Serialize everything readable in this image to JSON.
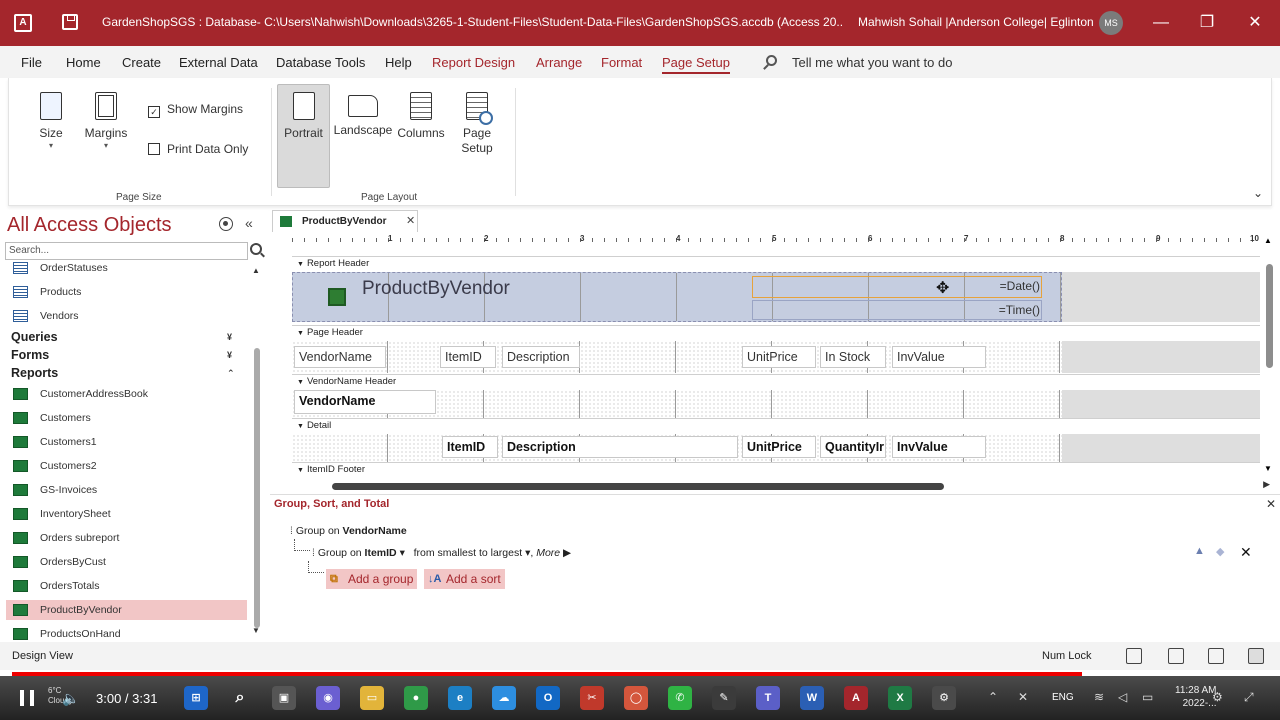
{
  "window": {
    "title": "GardenShopSGS : Database- C:\\Users\\Nahwish\\Downloads\\3265-1-Student-Files\\Student-Data-Files\\GardenShopSGS.accdb (Access 20...",
    "user": "Mahwish Sohail |Anderson College| Eglinton",
    "avatar": "MS",
    "minimize": "—",
    "restore": "❐",
    "close": "✕"
  },
  "menu": {
    "tabs": [
      "File",
      "Home",
      "Create",
      "External Data",
      "Database Tools",
      "Help",
      "Report Design",
      "Arrange",
      "Format",
      "Page Setup"
    ],
    "active": "Page Setup",
    "tell_me": "Tell me what you want to do"
  },
  "ribbon": {
    "size": "Size",
    "margins": "Margins",
    "show_margins": "Show Margins",
    "print_data_only": "Print Data Only",
    "group_page_size": "Page Size",
    "portrait": "Portrait",
    "landscape": "Landscape",
    "columns": "Columns",
    "page_setup_line1": "Page",
    "page_setup_line2": "Setup",
    "group_page_layout": "Page Layout",
    "caret": "▾",
    "collapse": "⌄",
    "show_margins_checked": true,
    "print_data_only_checked": false
  },
  "nav": {
    "title": "All Access Objects",
    "menu_icon": "nav-options-icon",
    "collapse": "«",
    "search_placeholder": "Search...",
    "tables": [
      "OrderStatuses",
      "Products",
      "Vendors"
    ],
    "queries_label": "Queries",
    "forms_label": "Forms",
    "reports_label": "Reports",
    "collapsed_arrow": "¥",
    "expanded_arrow": "⌃",
    "reports": [
      "CustomerAddressBook",
      "Customers",
      "Customers1",
      "Customers2",
      "GS-Invoices",
      "InventorySheet",
      "Orders subreport",
      "OrdersByCust",
      "OrdersTotals",
      "ProductByVendor",
      "ProductsOnHand"
    ],
    "selected": "ProductByVendor"
  },
  "document": {
    "tab_label": "ProductByVendor",
    "tab_close": "✕",
    "ruler_numbers": [
      "1",
      "2",
      "3",
      "4",
      "5",
      "6",
      "7",
      "8",
      "9",
      "10"
    ],
    "sections": {
      "report_header": "Report Header",
      "page_header": "Page Header",
      "vendorname_header": "VendorName Header",
      "detail": "Detail",
      "itemid_footer": "ItemID Footer"
    },
    "report_title": "ProductByVendor",
    "date_expr": "=Date()",
    "time_expr": "=Time()",
    "page_header_labels": {
      "vendor": "VendorName",
      "itemid": "ItemID",
      "description": "Description",
      "unitprice": "UnitPrice",
      "instock": "In Stock",
      "invvalue": "InvValue"
    },
    "vendor_header_field": "VendorName",
    "detail_fields": {
      "itemid": "ItemID",
      "description": "Description",
      "unitprice": "UnitPrice",
      "quantity": "QuantityIr",
      "invvalue": "InvValue"
    }
  },
  "group_sort": {
    "header": "Group, Sort, and Total",
    "close": "✕",
    "group_on_prefix": "Group on",
    "group1_field": "VendorName",
    "group2_field": "ItemID",
    "group2_order": "from smallest to largest",
    "more": "More ▶",
    "add_group": "Add a group",
    "add_sort": "Add a sort",
    "delete": "✕"
  },
  "status": {
    "view": "Design View",
    "num_lock": "Num Lock"
  },
  "video": {
    "time": "3:00 / 3:31",
    "progress": 0.852,
    "weather_temp": "6°C",
    "weather_desc": "Cloudy"
  },
  "taskbar": {
    "lang": "ENG",
    "clock_time": "11:28 AM",
    "clock_date": "2022-..."
  }
}
